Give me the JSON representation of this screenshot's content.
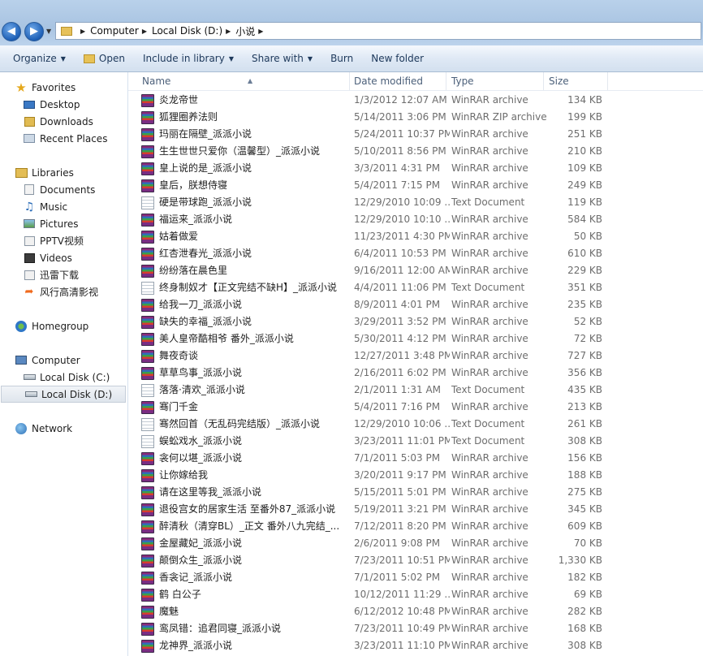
{
  "address": {
    "crumbs": [
      "Computer",
      "Local Disk (D:)",
      "小说"
    ]
  },
  "toolbar": {
    "organize": "Organize",
    "open": "Open",
    "include": "Include in library",
    "share": "Share with",
    "burn": "Burn",
    "new_folder": "New folder"
  },
  "nav": {
    "favorites": "Favorites",
    "desktop": "Desktop",
    "downloads": "Downloads",
    "recent": "Recent Places",
    "libraries": "Libraries",
    "documents": "Documents",
    "music": "Music",
    "pictures": "Pictures",
    "pptv": "PPTV视频",
    "videos": "Videos",
    "xunlei": "迅雷下载",
    "fengxing": "风行高清影视",
    "homegroup": "Homegroup",
    "computer": "Computer",
    "disk_c": "Local Disk (C:)",
    "disk_d": "Local Disk (D:)",
    "network": "Network"
  },
  "columns": {
    "name": "Name",
    "date": "Date modified",
    "type": "Type",
    "size": "Size"
  },
  "files": [
    {
      "name": "炎龙帝世",
      "date": "1/3/2012 12:07 AM",
      "type": "WinRAR archive",
      "size": "134 KB",
      "icon": "rar-icon"
    },
    {
      "name": "狐狸圈养法则",
      "date": "5/14/2011 3:06 PM",
      "type": "WinRAR ZIP archive",
      "size": "199 KB",
      "icon": "rar-icon"
    },
    {
      "name": "玛丽在隔壁_派派小说",
      "date": "5/24/2011 10:37 PM",
      "type": "WinRAR archive",
      "size": "251 KB",
      "icon": "rar-icon"
    },
    {
      "name": "生生世世只爱你（温馨型）_派派小说",
      "date": "5/10/2011 8:56 PM",
      "type": "WinRAR archive",
      "size": "210 KB",
      "icon": "rar-icon"
    },
    {
      "name": "皇上说的是_派派小说",
      "date": "3/3/2011 4:31 PM",
      "type": "WinRAR archive",
      "size": "109 KB",
      "icon": "rar-icon"
    },
    {
      "name": "皇后，朕想侍寝",
      "date": "5/4/2011 7:15 PM",
      "type": "WinRAR archive",
      "size": "249 KB",
      "icon": "rar-icon"
    },
    {
      "name": "硬是带球跑_派派小说",
      "date": "12/29/2010 10:09 ...",
      "type": "Text Document",
      "size": "119 KB",
      "icon": "text-icon"
    },
    {
      "name": "福运来_派派小说",
      "date": "12/29/2010 10:10 ...",
      "type": "WinRAR archive",
      "size": "584 KB",
      "icon": "rar-icon"
    },
    {
      "name": "姑着做爱",
      "date": "11/23/2011 4:30 PM",
      "type": "WinRAR archive",
      "size": "50 KB",
      "icon": "rar-icon"
    },
    {
      "name": "红杏泄春光_派派小说",
      "date": "6/4/2011 10:53 PM",
      "type": "WinRAR archive",
      "size": "610 KB",
      "icon": "rar-icon"
    },
    {
      "name": "纷纷落在晨色里",
      "date": "9/16/2011 12:00 AM",
      "type": "WinRAR archive",
      "size": "229 KB",
      "icon": "rar-icon"
    },
    {
      "name": "终身制奴才【正文完结不缺H】_派派小说",
      "date": "4/4/2011 11:06 PM",
      "type": "Text Document",
      "size": "351 KB",
      "icon": "text-icon"
    },
    {
      "name": "给我一刀_派派小说",
      "date": "8/9/2011 4:01 PM",
      "type": "WinRAR archive",
      "size": "235 KB",
      "icon": "rar-icon"
    },
    {
      "name": "缺失的幸福_派派小说",
      "date": "3/29/2011 3:52 PM",
      "type": "WinRAR archive",
      "size": "52 KB",
      "icon": "rar-icon"
    },
    {
      "name": "美人皇帝酷相爷 番外_派派小说",
      "date": "5/30/2011 4:12 PM",
      "type": "WinRAR archive",
      "size": "72 KB",
      "icon": "rar-icon"
    },
    {
      "name": "舞夜奇谈",
      "date": "12/27/2011 3:48 PM",
      "type": "WinRAR archive",
      "size": "727 KB",
      "icon": "rar-icon"
    },
    {
      "name": "草草鸟事_派派小说",
      "date": "2/16/2011 6:02 PM",
      "type": "WinRAR archive",
      "size": "356 KB",
      "icon": "rar-icon"
    },
    {
      "name": "落落·清欢_派派小说",
      "date": "2/1/2011 1:31 AM",
      "type": "Text Document",
      "size": "435 KB",
      "icon": "text-icon"
    },
    {
      "name": "骞门千金",
      "date": "5/4/2011 7:16 PM",
      "type": "WinRAR archive",
      "size": "213 KB",
      "icon": "rar-icon"
    },
    {
      "name": "骞然回首（无乱码完结版）_派派小说",
      "date": "12/29/2010 10:06 ...",
      "type": "Text Document",
      "size": "261 KB",
      "icon": "text-icon"
    },
    {
      "name": "蜈蚣戏水_派派小说",
      "date": "3/23/2011 11:01 PM",
      "type": "Text Document",
      "size": "308 KB",
      "icon": "text-icon"
    },
    {
      "name": "衾何以堪_派派小说",
      "date": "7/1/2011 5:03 PM",
      "type": "WinRAR archive",
      "size": "156 KB",
      "icon": "rar-icon"
    },
    {
      "name": "让你嫁给我",
      "date": "3/20/2011 9:17 PM",
      "type": "WinRAR archive",
      "size": "188 KB",
      "icon": "rar-icon"
    },
    {
      "name": "请在这里等我_派派小说",
      "date": "5/15/2011 5:01 PM",
      "type": "WinRAR archive",
      "size": "275 KB",
      "icon": "rar-icon"
    },
    {
      "name": "退役宫女的居家生活 至番外87_派派小说",
      "date": "5/19/2011 3:21 PM",
      "type": "WinRAR archive",
      "size": "345 KB",
      "icon": "rar-icon"
    },
    {
      "name": "醉清秋（清穿BL）_正文 番外八九完结_...",
      "date": "7/12/2011 8:20 PM",
      "type": "WinRAR archive",
      "size": "609 KB",
      "icon": "rar-icon"
    },
    {
      "name": "金屋藏妃_派派小说",
      "date": "2/6/2011 9:08 PM",
      "type": "WinRAR archive",
      "size": "70 KB",
      "icon": "rar-icon"
    },
    {
      "name": "颠倒众生_派派小说",
      "date": "7/23/2011 10:51 PM",
      "type": "WinRAR archive",
      "size": "1,330 KB",
      "icon": "rar-icon"
    },
    {
      "name": "香衾记_派派小说",
      "date": "7/1/2011 5:02 PM",
      "type": "WinRAR archive",
      "size": "182 KB",
      "icon": "rar-icon"
    },
    {
      "name": "鹤 白公子",
      "date": "10/12/2011 11:29 ...",
      "type": "WinRAR archive",
      "size": "69 KB",
      "icon": "rar-icon"
    },
    {
      "name": "魔魅",
      "date": "6/12/2012 10:48 PM",
      "type": "WinRAR archive",
      "size": "282 KB",
      "icon": "rar-icon"
    },
    {
      "name": "鸾凤错：追君同寝_派派小说",
      "date": "7/23/2011 10:49 PM",
      "type": "WinRAR archive",
      "size": "168 KB",
      "icon": "rar-icon"
    },
    {
      "name": "龙神界_派派小说",
      "date": "3/23/2011 11:10 PM",
      "type": "WinRAR archive",
      "size": "308 KB",
      "icon": "rar-icon"
    }
  ]
}
